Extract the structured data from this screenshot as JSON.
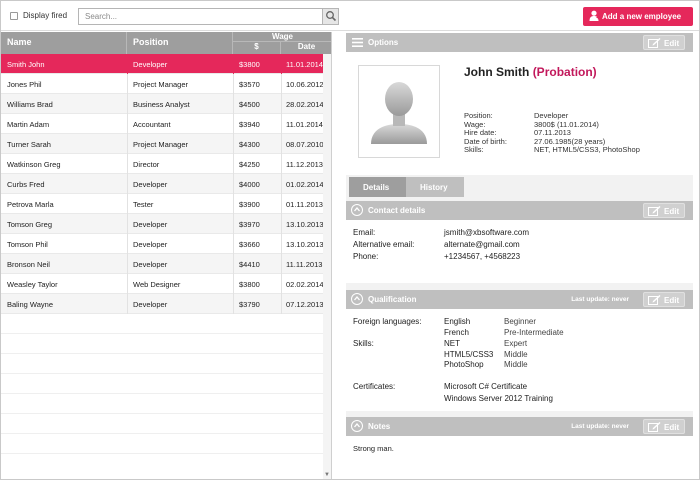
{
  "toolbar": {
    "display_fired_label": "Display fired",
    "search_placeholder": "Search...",
    "add_button_label": "Add a new employee",
    "accent_color": "#e5285b"
  },
  "grid": {
    "headers": {
      "name": "Name",
      "position": "Position",
      "wage": "Wage",
      "wage_currency": "$",
      "date": "Date"
    },
    "rows": [
      {
        "name": "Smith John",
        "position": "Developer",
        "wage": "$3800",
        "date": "11.01.2014",
        "selected": true
      },
      {
        "name": "Jones Phil",
        "position": "Project Manager",
        "wage": "$3570",
        "date": "10.06.2012"
      },
      {
        "name": "Williams Brad",
        "position": "Business Analyst",
        "wage": "$4500",
        "date": "28.02.2014"
      },
      {
        "name": "Martin Adam",
        "position": "Accountant",
        "wage": "$3940",
        "date": "11.01.2014"
      },
      {
        "name": "Turner Sarah",
        "position": "Project Manager",
        "wage": "$4300",
        "date": "08.07.2010"
      },
      {
        "name": "Watkinson Greg",
        "position": "Director",
        "wage": "$4250",
        "date": "11.12.2013"
      },
      {
        "name": "Curbs Fred",
        "position": "Developer",
        "wage": "$4000",
        "date": "01.02.2014"
      },
      {
        "name": "Petrova Marla",
        "position": "Tester",
        "wage": "$3900",
        "date": "01.11.2013"
      },
      {
        "name": "Tomson Greg",
        "position": "Developer",
        "wage": "$3970",
        "date": "13.10.2013"
      },
      {
        "name": "Tomson Phil",
        "position": "Developer",
        "wage": "$3660",
        "date": "13.10.2013"
      },
      {
        "name": "Bronson Neil",
        "position": "Developer",
        "wage": "$4410",
        "date": "11.11.2013"
      },
      {
        "name": "Weasley Taylor",
        "position": "Web Designer",
        "wage": "$3800",
        "date": "02.02.2014"
      },
      {
        "name": "Baling Wayne",
        "position": "Developer",
        "wage": "$3790",
        "date": "07.12.2013"
      }
    ]
  },
  "panel": {
    "options_title": "Options",
    "edit_label": "Edit",
    "employee": {
      "name": "John Smith",
      "status": "(Probation)",
      "fields": [
        {
          "label": "Position:",
          "value": "Developer"
        },
        {
          "label": "Wage:",
          "value": "3800$ (11.01.2014)"
        },
        {
          "label": "Hire date:",
          "value": "07.11.2013"
        },
        {
          "label": "Date of birth:",
          "value": "27.06.1985(28 years)"
        },
        {
          "label": "Skills:",
          "value": "NET, HTML5/CSS3, PhotoShop"
        }
      ]
    },
    "tabs": {
      "details": "Details",
      "history": "History"
    },
    "contact": {
      "title": "Contact details",
      "email_label": "Email:",
      "email": "jsmith@xbsoftware.com",
      "alt_email_label": "Alternative email:",
      "alt_email": "alternate@gmail.com",
      "phone_label": "Phone:",
      "phone": "+1234567, +4568223"
    },
    "qualification": {
      "title": "Qualification",
      "last_update": "Last update: never",
      "languages_label": "Foreign languages:",
      "languages": [
        {
          "name": "English",
          "level": "Beginner"
        },
        {
          "name": "French",
          "level": "Pre-Intermediate"
        }
      ],
      "skills_label": "Skills:",
      "skills": [
        {
          "name": "NET",
          "level": "Expert"
        },
        {
          "name": "HTML5/CSS3",
          "level": "Middle"
        },
        {
          "name": "PhotoShop",
          "level": "Middle"
        }
      ],
      "certificates_label": "Certificates:",
      "certificates": [
        "Microsoft C# Certificate",
        "Windows Server 2012 Training"
      ]
    },
    "notes": {
      "title": "Notes",
      "last_update": "Last update: never",
      "text": "Strong man."
    }
  }
}
